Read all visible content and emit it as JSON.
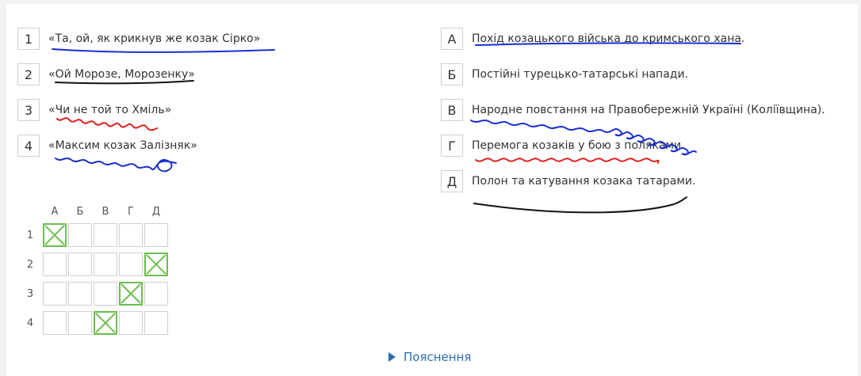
{
  "left_items": [
    {
      "num": "1",
      "text": "«Та, ой, як крикнув же козак Сірко»"
    },
    {
      "num": "2",
      "text": "«Ой Морозе, Морозенку»"
    },
    {
      "num": "3",
      "text": "«Чи не той то Хміль»"
    },
    {
      "num": "4",
      "text": "«Максим козак Залізняк»"
    }
  ],
  "right_items": [
    {
      "letter": "А",
      "text": "Похід козацького війська до кримського хана."
    },
    {
      "letter": "Б",
      "text": "Постійні турецько-татарські напади."
    },
    {
      "letter": "В",
      "text": "Народне повстання на Правобережній Україні (Коліївщина)."
    },
    {
      "letter": "Г",
      "text": "Перемога козаків у бою з поляками."
    },
    {
      "letter": "Д",
      "text": "Полон та катування козака татарами."
    }
  ],
  "grid": {
    "columns": [
      "А",
      "Б",
      "В",
      "Г",
      "Д"
    ],
    "rows": [
      "1",
      "2",
      "3",
      "4"
    ],
    "answers": {
      "1": "А",
      "2": "Д",
      "3": "Г",
      "4": "В"
    }
  },
  "explanation_label": "Пояснення",
  "colors": {
    "check": "#6cbf4f",
    "link": "#2b6cb0",
    "blue_ink": "#1a2fd0",
    "red_ink": "#e0201c",
    "black_ink": "#111111"
  }
}
